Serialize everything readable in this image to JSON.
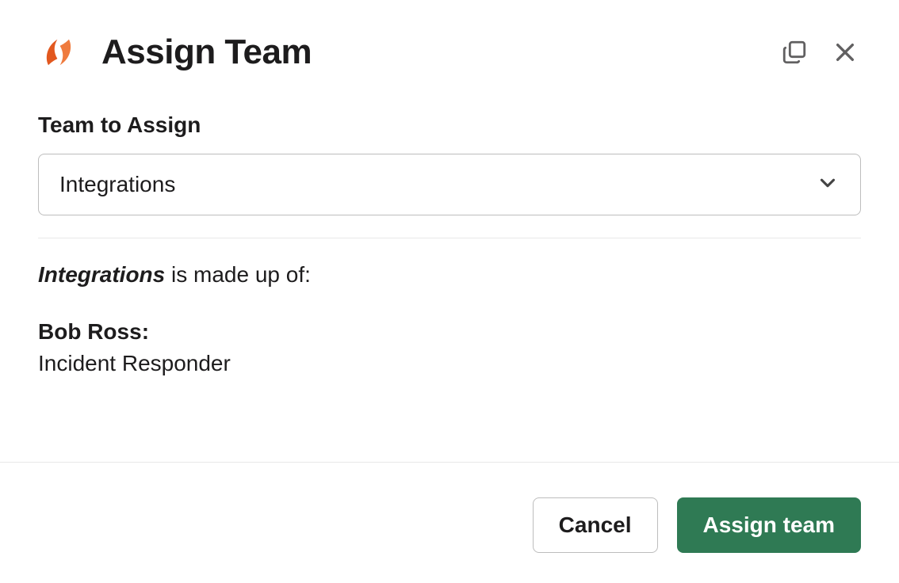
{
  "header": {
    "title": "Assign Team"
  },
  "form": {
    "team_label": "Team to Assign",
    "team_selected": "Integrations"
  },
  "summary": {
    "team_name": "Integrations",
    "suffix_text": " is made up of:"
  },
  "members": [
    {
      "name": "Bob Ross",
      "role": "Incident Responder"
    }
  ],
  "footer": {
    "cancel_label": "Cancel",
    "submit_label": "Assign team"
  }
}
